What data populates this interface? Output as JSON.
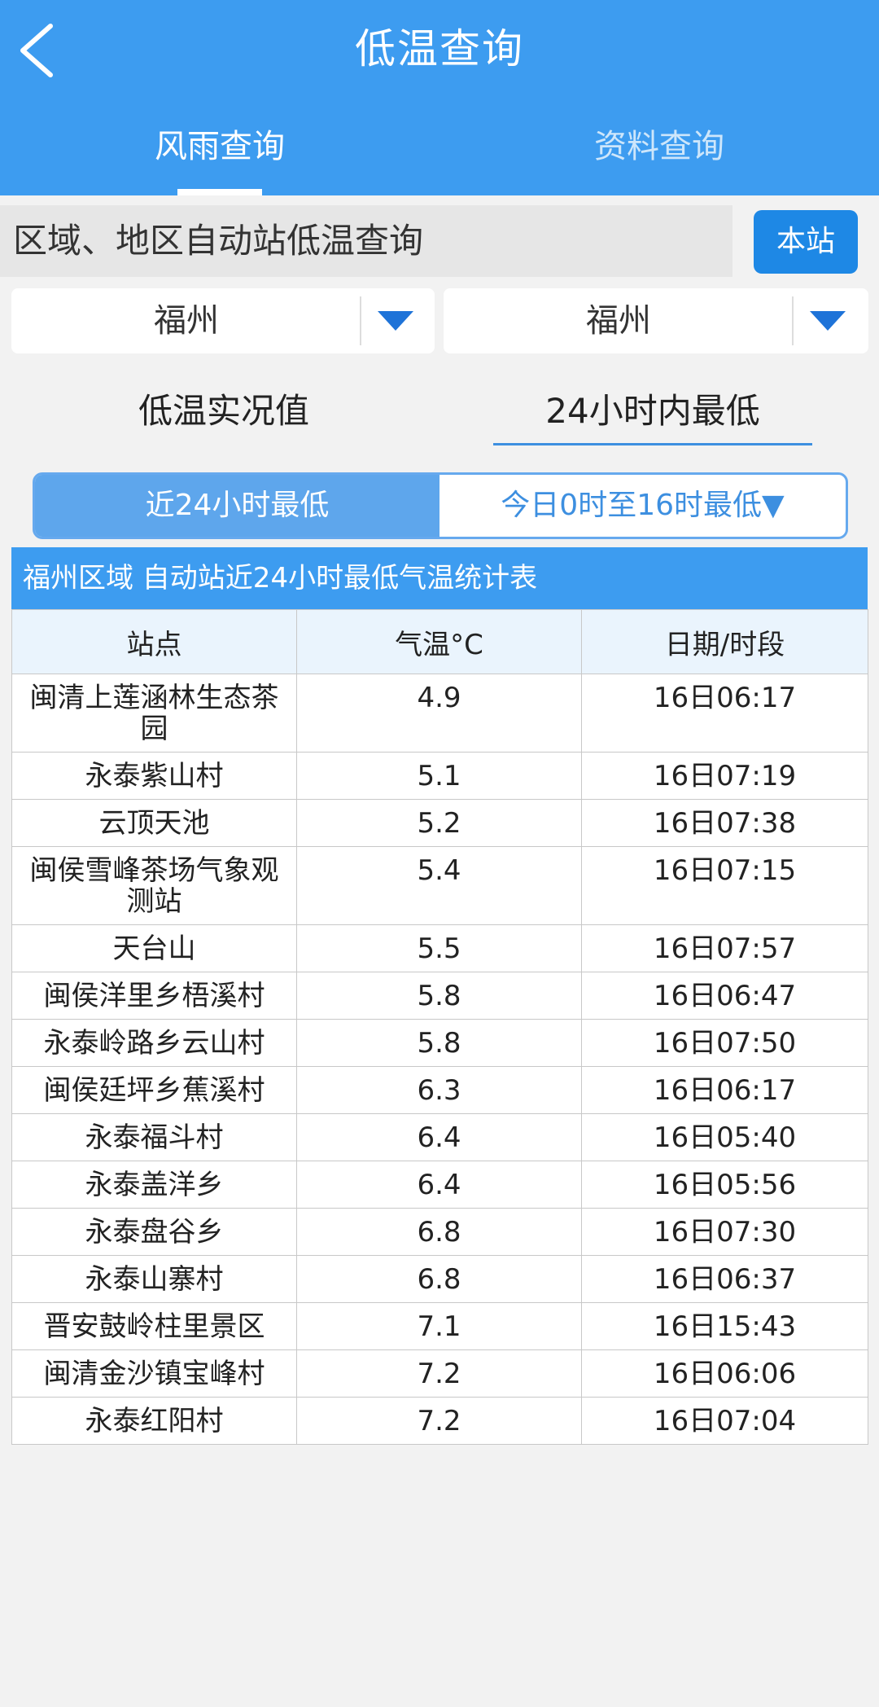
{
  "header": {
    "title": "低温查询",
    "tabs": [
      {
        "label": "风雨查询"
      },
      {
        "label": "资料查询"
      }
    ]
  },
  "region": {
    "label": "区域、地区自动站低温查询",
    "button": "本站"
  },
  "selects": {
    "city": "福州",
    "district": "福州"
  },
  "subtabs": {
    "realtime": "低温实况值",
    "lowest24": "24小时内最低"
  },
  "segment": {
    "active": "近24小时最低",
    "inactive": "今日0时至16时最低▼"
  },
  "table": {
    "caption": "福州区域 自动站近24小时最低气温统计表",
    "headers": [
      "站点",
      "气温°C",
      "日期/时段"
    ],
    "rows": [
      {
        "station": "闽清上莲涵林生态茶园",
        "temp": "4.9",
        "time": "16日06:17"
      },
      {
        "station": "永泰紫山村",
        "temp": "5.1",
        "time": "16日07:19"
      },
      {
        "station": "云顶天池",
        "temp": "5.2",
        "time": "16日07:38"
      },
      {
        "station": "闽侯雪峰茶场气象观测站",
        "temp": "5.4",
        "time": "16日07:15"
      },
      {
        "station": "天台山",
        "temp": "5.5",
        "time": "16日07:57"
      },
      {
        "station": "闽侯洋里乡梧溪村",
        "temp": "5.8",
        "time": "16日06:47"
      },
      {
        "station": "永泰岭路乡云山村",
        "temp": "5.8",
        "time": "16日07:50"
      },
      {
        "station": "闽侯廷坪乡蕉溪村",
        "temp": "6.3",
        "time": "16日06:17"
      },
      {
        "station": "永泰福斗村",
        "temp": "6.4",
        "time": "16日05:40"
      },
      {
        "station": "永泰盖洋乡",
        "temp": "6.4",
        "time": "16日05:56"
      },
      {
        "station": "永泰盘谷乡",
        "temp": "6.8",
        "time": "16日07:30"
      },
      {
        "station": "永泰山寨村",
        "temp": "6.8",
        "time": "16日06:37"
      },
      {
        "station": "晋安鼓岭柱里景区",
        "temp": "7.1",
        "time": "16日15:43"
      },
      {
        "station": "闽清金沙镇宝峰村",
        "temp": "7.2",
        "time": "16日06:06"
      },
      {
        "station": "永泰红阳村",
        "temp": "7.2",
        "time": "16日07:04"
      }
    ]
  }
}
